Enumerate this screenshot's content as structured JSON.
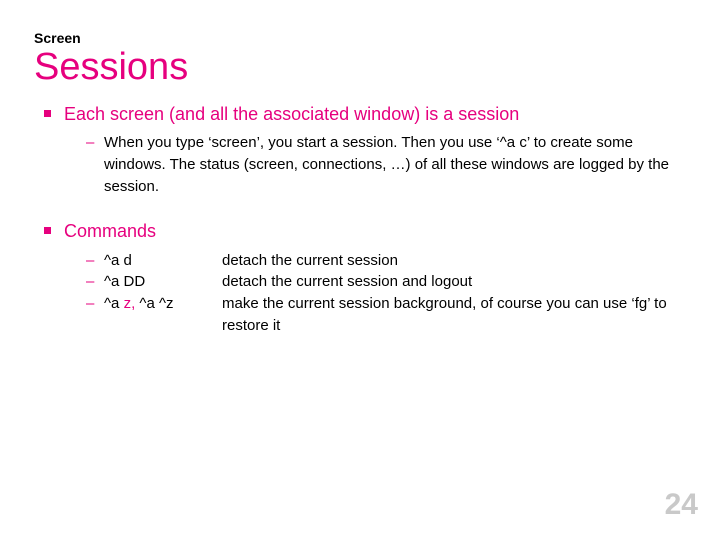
{
  "kicker": "Screen",
  "title": "Sessions",
  "bullets": [
    {
      "lead": "Each screen (and all the associated window) is a session",
      "sub": [
        "When you type ‘screen’, you start a session. Then you use ‘^a c’ to create some windows. The status (screen, connections, …) of all these windows are logged by the session."
      ]
    },
    {
      "lead": "Commands",
      "commands": [
        {
          "key_prefix": "^a d",
          "desc": "detach the current session"
        },
        {
          "key_prefix": "^a DD",
          "desc": "detach the current session and logout"
        },
        {
          "key_prefix": "^a ",
          "key_accent": "z",
          "key_sep": ", ",
          "key_suffix": "^a ^z",
          "desc": "make the current session background, of course you can use ‘fg’ to restore it"
        }
      ]
    }
  ],
  "page_number": "24"
}
